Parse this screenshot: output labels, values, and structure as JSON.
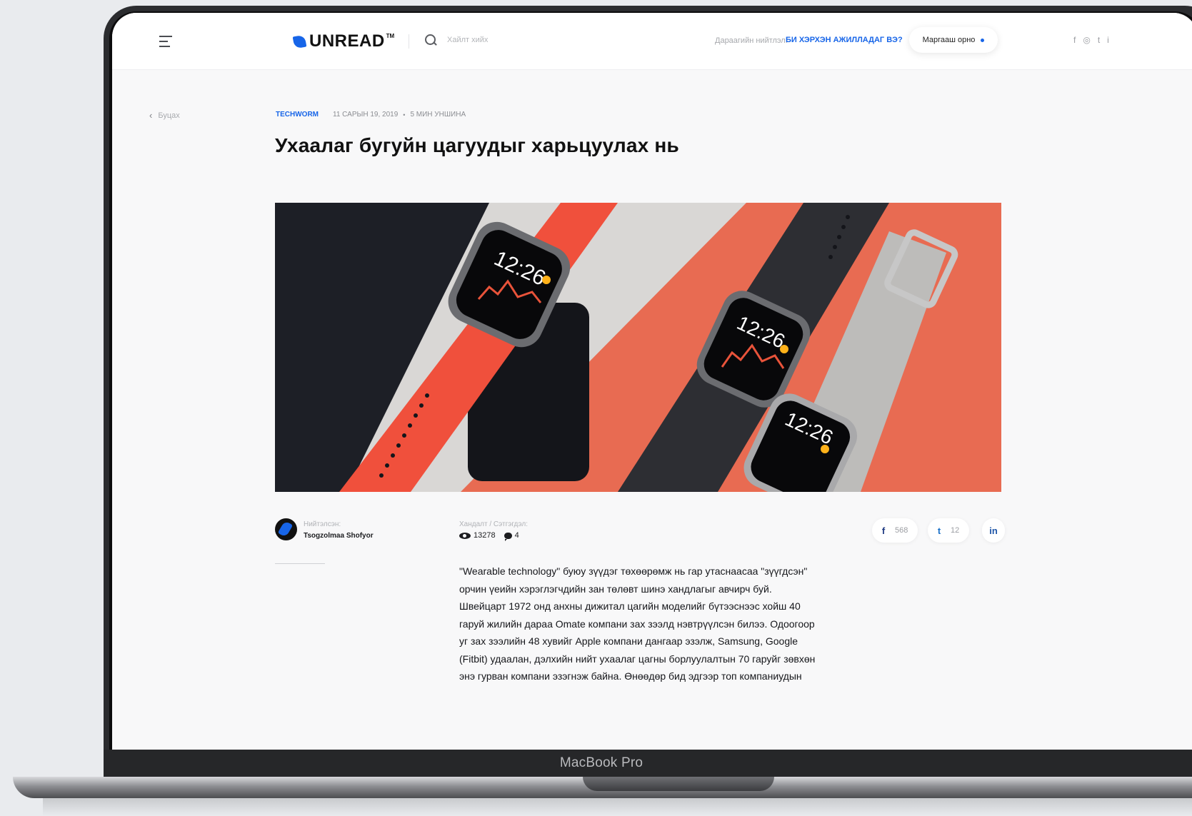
{
  "device": {
    "label": "MacBook Pro"
  },
  "header": {
    "logo_text": "UNREAD",
    "logo_tm": "TM",
    "search_placeholder": "Хайлт хийх",
    "next_label": "Дараагийн нийтлэл:",
    "next_title": "БИ ХЭРХЭН АЖИЛЛАДАГ ВЭ?",
    "tomorrow_label": "Маргааш орно",
    "social": [
      "f",
      "◎",
      "t",
      "i"
    ]
  },
  "nav": {
    "back_label": "Буцах"
  },
  "article": {
    "category": "TECHWORM",
    "date": "11 САРЫН 19, 2019",
    "read_time": "5 МИН УНШИНА",
    "title": "Ухаалаг бугуйн цагуудыг харьцуулах нь",
    "hero": {
      "clock_time": "12:26"
    },
    "author_label": "Нийтэлсэн:",
    "author_name": "Tsogzolmaa Shofyor",
    "stats_label": "Хандалт / Сэтгэгдэл:",
    "views": "13278",
    "comments": "4",
    "body": "\"Wearable technology\" буюу зүүдэг төхөөрөмж нь гар утаснаасаа \"зүүгдсэн\" орчин үеийн хэрэглэгчдийн зан төлөвт шинэ хандлагыг авчирч буй. Швейцарт 1972 онд анхны дижитал цагийн моделийг бүтээснээс хойш 40 гаруй жилийн дараа Omate компани зах зээлд нэвтрүүлсэн билээ. Одоогоор уг зах зээлийн 48 хувийг Apple компани дангаар эзэлж, Samsung, Google (Fitbit) удаалан, дэлхийн нийт ухаалаг цагны борлуулалтын 70 гаруйг зөвхөн энэ гурван компани эзэгнэж байна. Өнөөдөр бид эдгээр топ компаниудын"
  },
  "share": {
    "facebook_icon": "f",
    "facebook_count": "568",
    "twitter_icon": "t",
    "twitter_count": "12",
    "linkedin_icon": "in"
  },
  "colors": {
    "accent": "#1765e8",
    "hero_coral": "#e86b52",
    "strap_red": "#f0503c"
  }
}
